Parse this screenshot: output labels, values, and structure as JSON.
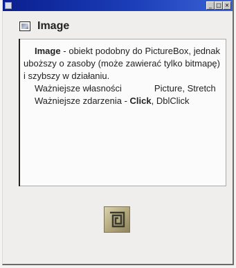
{
  "window": {
    "buttons": {
      "minimize": "_",
      "maximize": "□",
      "close": "×"
    }
  },
  "header": {
    "title": "Image",
    "icon": "image-control-icon"
  },
  "content": {
    "p1_term": "Image",
    "p1_rest": " - obiekt podobny do PictureBox, jednak uboższy o zasoby (może zawierać tylko bitmapę) i szybszy w działaniu.",
    "p2_label": "Ważniejsze własności",
    "p2_values": "Picture, Stretch",
    "p3_label": "Ważniejsze zdarzenia - ",
    "p3_events": "Click",
    "p3_sep": ", ",
    "p3_events2": "DblClick"
  },
  "toolbox_icon": {
    "name": "image-tool-icon"
  }
}
